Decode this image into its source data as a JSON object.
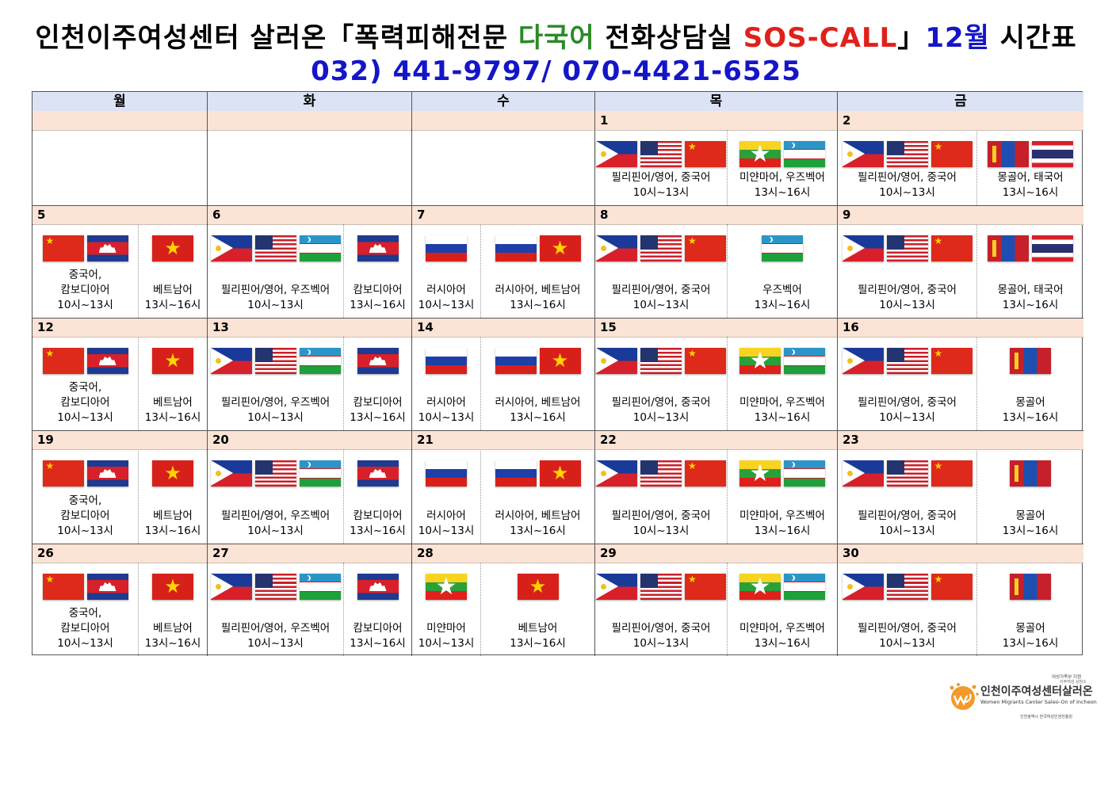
{
  "title": {
    "part1": "인천이주여성센터 살러온「폭력피해전문 ",
    "part2": "다국어",
    "part3": " 전화상담실 ",
    "part4": "SOS-CALL",
    "part5": "」",
    "part6": "12월",
    "part7": " 시간표"
  },
  "phone": "032) 441-9797/ 070-4421-6525",
  "days": [
    "월",
    "화",
    "수",
    "목",
    "금"
  ],
  "weeks": [
    {
      "dates": [
        "",
        "",
        "",
        "1",
        "2"
      ],
      "slots": [
        [],
        [],
        [],
        [
          {
            "flags": [
              "ph",
              "us",
              "cn"
            ],
            "lang": "필리핀어/영어, 중국어",
            "time": "10시~13시"
          },
          {
            "flags": [
              "mm",
              "uz"
            ],
            "lang": "미얀마어, 우즈벡어",
            "time": "13시~16시"
          }
        ],
        [
          {
            "flags": [
              "ph",
              "us",
              "cn"
            ],
            "lang": "필리핀어/영어, 중국어",
            "time": "10시~13시"
          },
          {
            "flags": [
              "mn",
              "th"
            ],
            "lang": "몽골어, 태국어",
            "time": "13시~16시"
          }
        ]
      ]
    },
    {
      "dates": [
        "5",
        "6",
        "7",
        "8",
        "9"
      ],
      "slots": [
        [
          {
            "flags": [
              "cn",
              "kh"
            ],
            "lang": "중국어,\n캄보디아어",
            "time": "10시~13시"
          },
          {
            "flags": [
              "vn"
            ],
            "lang": "베트남어",
            "time": "13시~16시"
          }
        ],
        [
          {
            "flags": [
              "ph",
              "us",
              "uz"
            ],
            "lang": "필리핀어/영어, 우즈벡어",
            "time": "10시~13시"
          },
          {
            "flags": [
              "kh"
            ],
            "lang": "캄보디아어",
            "time": "13시~16시"
          }
        ],
        [
          {
            "flags": [
              "ru"
            ],
            "lang": "러시아어",
            "time": "10시~13시"
          },
          {
            "flags": [
              "ru",
              "vn"
            ],
            "lang": "러시아어, 베트남어",
            "time": "13시~16시"
          }
        ],
        [
          {
            "flags": [
              "ph",
              "us",
              "cn"
            ],
            "lang": "필리핀어/영어, 중국어",
            "time": "10시~13시"
          },
          {
            "flags": [
              "uz"
            ],
            "lang": "우즈벡어",
            "time": "13시~16시"
          }
        ],
        [
          {
            "flags": [
              "ph",
              "us",
              "cn"
            ],
            "lang": "필리핀어/영어, 중국어",
            "time": "10시~13시"
          },
          {
            "flags": [
              "mn",
              "th"
            ],
            "lang": "몽골어, 태국어",
            "time": "13시~16시"
          }
        ]
      ]
    },
    {
      "dates": [
        "12",
        "13",
        "14",
        "15",
        "16"
      ],
      "slots": [
        [
          {
            "flags": [
              "cn",
              "kh"
            ],
            "lang": "중국어,\n캄보디아어",
            "time": "10시~13시"
          },
          {
            "flags": [
              "vn"
            ],
            "lang": "베트남어",
            "time": "13시~16시"
          }
        ],
        [
          {
            "flags": [
              "ph",
              "us",
              "uz"
            ],
            "lang": "필리핀어/영어, 우즈벡어",
            "time": "10시~13시"
          },
          {
            "flags": [
              "kh"
            ],
            "lang": "캄보디아어",
            "time": "13시~16시"
          }
        ],
        [
          {
            "flags": [
              "ru"
            ],
            "lang": "러시아어",
            "time": "10시~13시"
          },
          {
            "flags": [
              "ru",
              "vn"
            ],
            "lang": "러시아어, 베트남어",
            "time": "13시~16시"
          }
        ],
        [
          {
            "flags": [
              "ph",
              "us",
              "cn"
            ],
            "lang": "필리핀어/영어, 중국어",
            "time": "10시~13시"
          },
          {
            "flags": [
              "mm",
              "uz"
            ],
            "lang": "미얀마어, 우즈벡어",
            "time": "13시~16시"
          }
        ],
        [
          {
            "flags": [
              "ph",
              "us",
              "cn"
            ],
            "lang": "필리핀어/영어, 중국어",
            "time": "10시~13시"
          },
          {
            "flags": [
              "mn"
            ],
            "lang": "몽골어",
            "time": "13시~16시"
          }
        ]
      ]
    },
    {
      "dates": [
        "19",
        "20",
        "21",
        "22",
        "23"
      ],
      "slots": [
        [
          {
            "flags": [
              "cn",
              "kh"
            ],
            "lang": "중국어,\n캄보디아어",
            "time": "10시~13시"
          },
          {
            "flags": [
              "vn"
            ],
            "lang": "베트남어",
            "time": "13시~16시"
          }
        ],
        [
          {
            "flags": [
              "ph",
              "us",
              "uz"
            ],
            "lang": "필리핀어/영어, 우즈벡어",
            "time": "10시~13시"
          },
          {
            "flags": [
              "kh"
            ],
            "lang": "캄보디아어",
            "time": "13시~16시"
          }
        ],
        [
          {
            "flags": [
              "ru"
            ],
            "lang": "러시아어",
            "time": "10시~13시"
          },
          {
            "flags": [
              "ru",
              "vn"
            ],
            "lang": "러시아어, 베트남어",
            "time": "13시~16시"
          }
        ],
        [
          {
            "flags": [
              "ph",
              "us",
              "cn"
            ],
            "lang": "필리핀어/영어, 중국어",
            "time": "10시~13시"
          },
          {
            "flags": [
              "mm",
              "uz"
            ],
            "lang": "미얀마어, 우즈벡어",
            "time": "13시~16시"
          }
        ],
        [
          {
            "flags": [
              "ph",
              "us",
              "cn"
            ],
            "lang": "필리핀어/영어, 중국어",
            "time": "10시~13시"
          },
          {
            "flags": [
              "mn"
            ],
            "lang": "몽골어",
            "time": "13시~16시"
          }
        ]
      ]
    },
    {
      "dates": [
        "26",
        "27",
        "28",
        "29",
        "30"
      ],
      "slots": [
        [
          {
            "flags": [
              "cn",
              "kh"
            ],
            "lang": "중국어,\n캄보디아어",
            "time": "10시~13시"
          },
          {
            "flags": [
              "vn"
            ],
            "lang": "베트남어",
            "time": "13시~16시"
          }
        ],
        [
          {
            "flags": [
              "ph",
              "us",
              "uz"
            ],
            "lang": "필리핀어/영어, 우즈벡어",
            "time": "10시~13시"
          },
          {
            "flags": [
              "kh"
            ],
            "lang": "캄보디아어",
            "time": "13시~16시"
          }
        ],
        [
          {
            "flags": [
              "mm"
            ],
            "lang": "미얀마어",
            "time": "10시~13시"
          },
          {
            "flags": [
              "vn"
            ],
            "lang": "베트남어",
            "time": "13시~16시"
          }
        ],
        [
          {
            "flags": [
              "ph",
              "us",
              "cn"
            ],
            "lang": "필리핀어/영어, 중국어",
            "time": "10시~13시"
          },
          {
            "flags": [
              "mm",
              "uz"
            ],
            "lang": "미얀마어, 우즈벡어",
            "time": "13시~16시"
          }
        ],
        [
          {
            "flags": [
              "ph",
              "us",
              "cn"
            ],
            "lang": "필리핀어/영어, 중국어",
            "time": "10시~13시"
          },
          {
            "flags": [
              "mn"
            ],
            "lang": "몽골어",
            "time": "13시~16시"
          }
        ]
      ]
    }
  ],
  "logo": {
    "name": "인천이주여성센터살러온",
    "english": "Women Migrants Center Saleo-On of Incheon",
    "top_line1": "여성가족부 지원",
    "top_line2": "이주여성 상담소",
    "bottom": "인천광역시  한국여성인권진흥원"
  }
}
